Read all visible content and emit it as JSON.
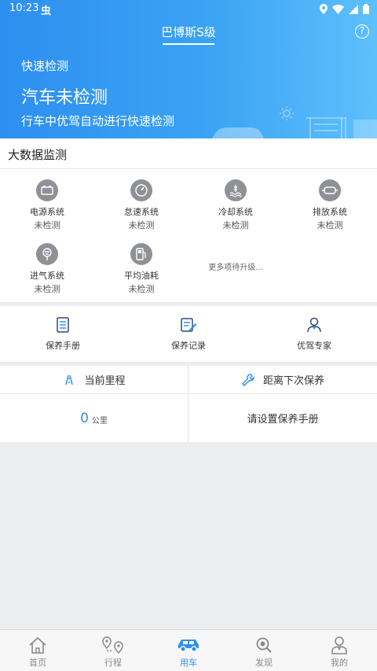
{
  "status_bar": {
    "time": "10:23",
    "notif": "虫"
  },
  "header": {
    "title": "巴博斯S级",
    "help": "?"
  },
  "quick_check": {
    "section_title": "快速检测",
    "status": "汽车未检测",
    "description": "行车中优驾自动进行快速检测"
  },
  "big_data": {
    "title": "大数据监测",
    "items": [
      {
        "name": "电源系统",
        "value": "未检测",
        "icon": "battery-icon"
      },
      {
        "name": "怠速系统",
        "value": "未检测",
        "icon": "speedometer-icon"
      },
      {
        "name": "冷却系统",
        "value": "未检测",
        "icon": "coolant-icon"
      },
      {
        "name": "排放系统",
        "value": "未检测",
        "icon": "exhaust-icon"
      },
      {
        "name": "进气系统",
        "value": "未检测",
        "icon": "air-intake-icon"
      },
      {
        "name": "平均油耗",
        "value": "未检测",
        "icon": "fuel-pump-icon"
      }
    ],
    "more": "更多项待升级..."
  },
  "tools": [
    {
      "label": "保养手册",
      "icon": "manual-icon"
    },
    {
      "label": "保养记录",
      "icon": "record-icon"
    },
    {
      "label": "优驾专家",
      "icon": "expert-icon"
    }
  ],
  "stats": {
    "mileage_label": "当前里程",
    "mileage_value": "0",
    "mileage_unit": "公里",
    "next_maintenance_label": "距离下次保养",
    "next_maintenance_value": "请设置保养手册"
  },
  "tabs": [
    {
      "label": "首页",
      "icon": "home-icon",
      "active": false
    },
    {
      "label": "行程",
      "icon": "trip-icon",
      "active": false
    },
    {
      "label": "用车",
      "icon": "car-icon",
      "active": true
    },
    {
      "label": "发现",
      "icon": "discover-icon",
      "active": false
    },
    {
      "label": "我的",
      "icon": "profile-icon",
      "active": false
    }
  ],
  "colors": {
    "primary": "#2d8ff0",
    "icon_gray": "#8e9196",
    "background": "#ecedf1"
  }
}
